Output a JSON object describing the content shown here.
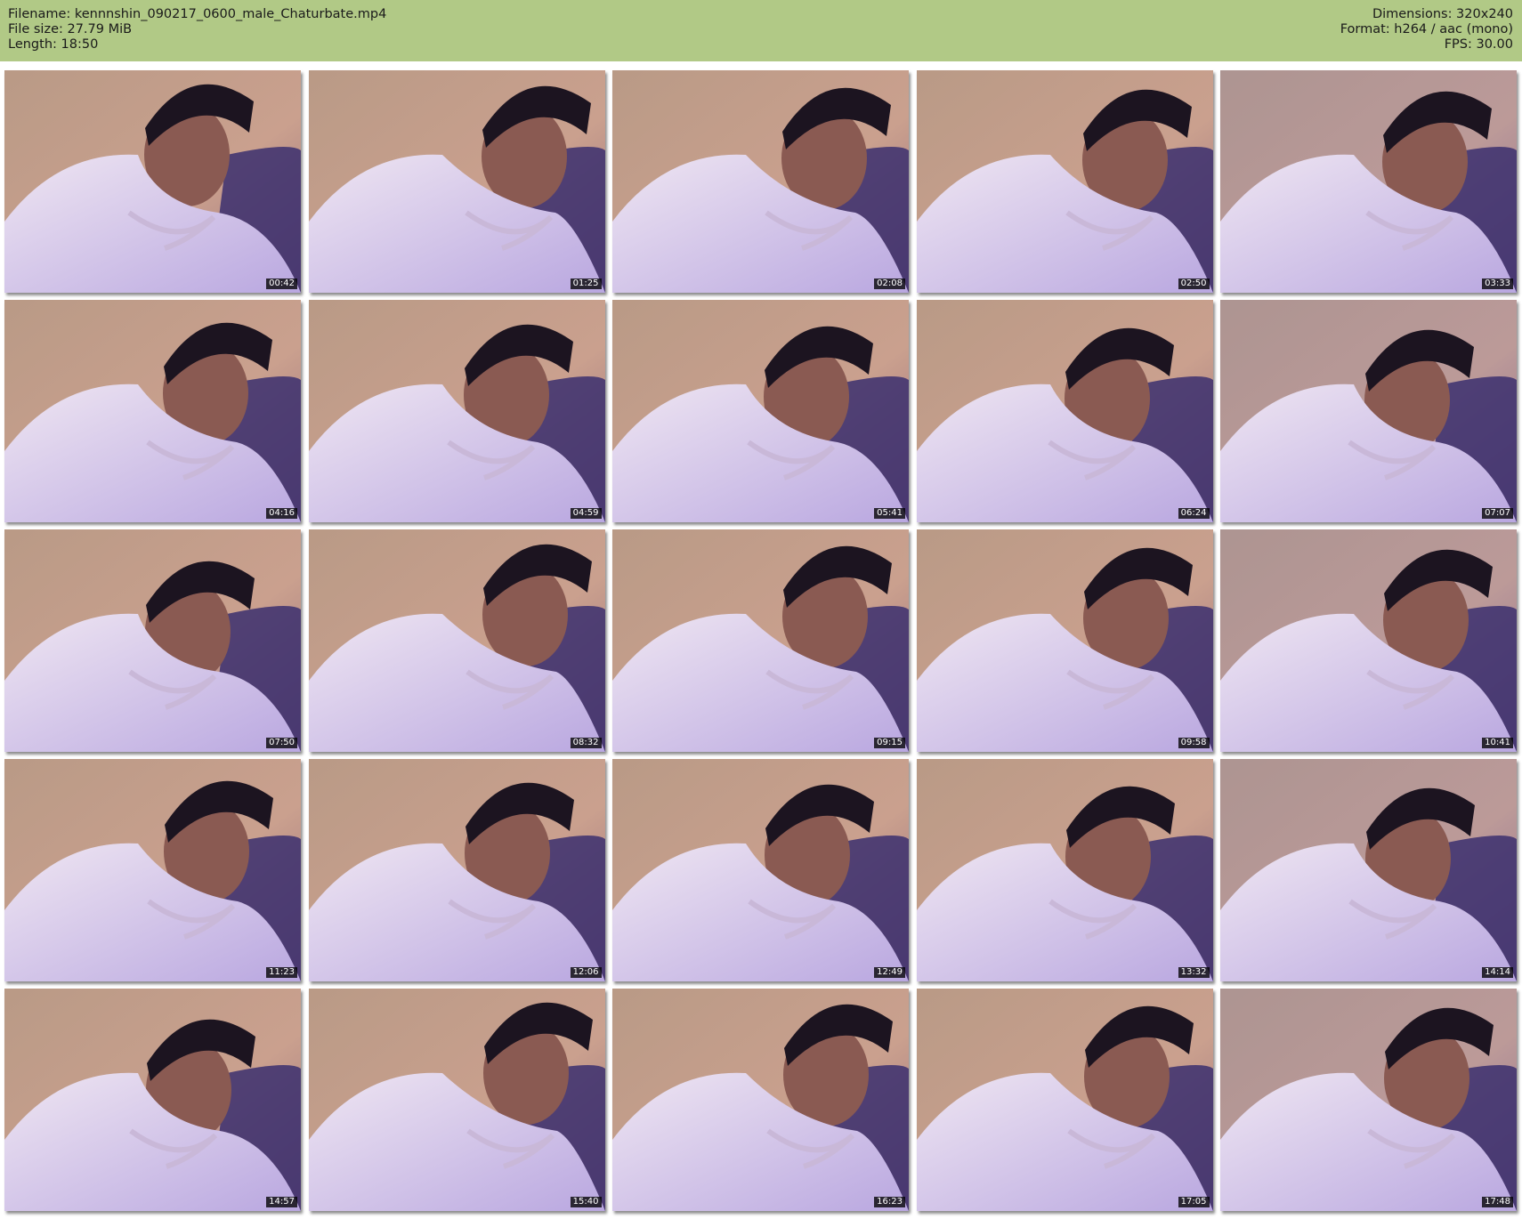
{
  "header": {
    "filename_label": "Filename: kennnshin_090217_0600_male_Chaturbate.mp4",
    "filesize_label": "File size: 27.79 MiB",
    "length_label": "Length: 18:50",
    "dimensions_label": "Dimensions: 320x240",
    "format_label": "Format: h264 / aac (mono)",
    "fps_label": "FPS: 30.00"
  },
  "colors": {
    "header_bg": "#b1c986",
    "wall": "#caa08e",
    "shirt": "#e6dcee",
    "couch": "#3b2f6e",
    "cap": "#1c1420",
    "skin": "#8a5a52"
  },
  "thumbnails": [
    {
      "timestamp": "00:42"
    },
    {
      "timestamp": "01:25"
    },
    {
      "timestamp": "02:08"
    },
    {
      "timestamp": "02:50"
    },
    {
      "timestamp": "03:33"
    },
    {
      "timestamp": "04:16"
    },
    {
      "timestamp": "04:59"
    },
    {
      "timestamp": "05:41"
    },
    {
      "timestamp": "06:24"
    },
    {
      "timestamp": "07:07"
    },
    {
      "timestamp": "07:50"
    },
    {
      "timestamp": "08:32"
    },
    {
      "timestamp": "09:15"
    },
    {
      "timestamp": "09:58"
    },
    {
      "timestamp": "10:41"
    },
    {
      "timestamp": "11:23"
    },
    {
      "timestamp": "12:06"
    },
    {
      "timestamp": "12:49"
    },
    {
      "timestamp": "13:32"
    },
    {
      "timestamp": "14:14"
    },
    {
      "timestamp": "14:57"
    },
    {
      "timestamp": "15:40"
    },
    {
      "timestamp": "16:23"
    },
    {
      "timestamp": "17:05"
    },
    {
      "timestamp": "17:48"
    }
  ]
}
